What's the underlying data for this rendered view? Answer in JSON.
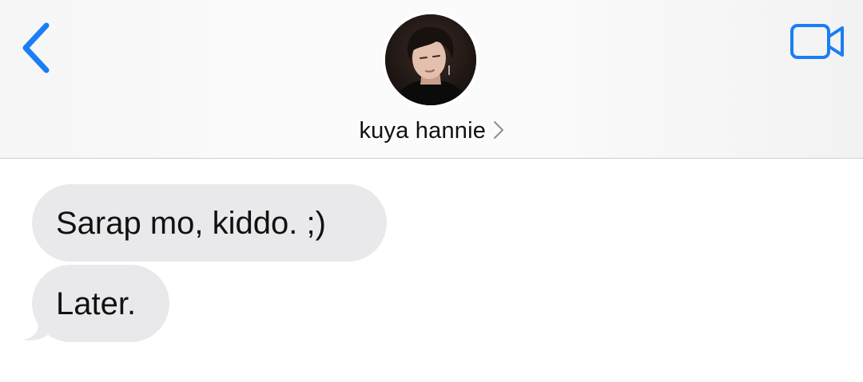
{
  "header": {
    "back_icon": "chevron-left-icon",
    "video_icon": "video-camera-icon",
    "contact_name": "kuya hannie",
    "contact_chevron_icon": "chevron-right-icon",
    "accent_color": "#1a7ef5"
  },
  "messages": [
    {
      "direction": "incoming",
      "text": "Sarap mo, kiddo. ;)"
    },
    {
      "direction": "incoming",
      "text": "Later."
    }
  ],
  "colors": {
    "incoming_bubble": "#e9e9eb",
    "text": "#111111"
  }
}
